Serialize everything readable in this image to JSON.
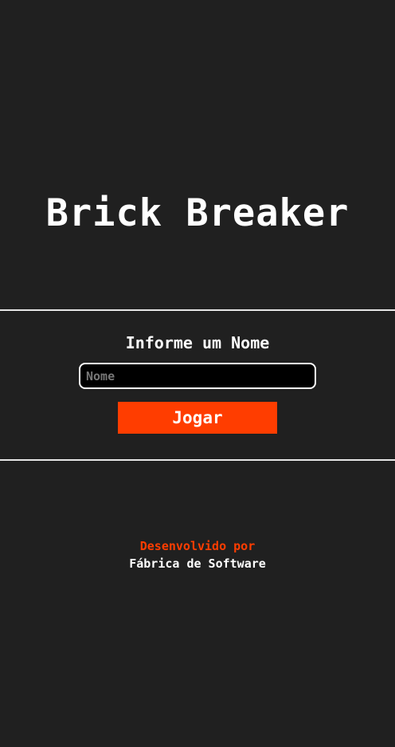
{
  "game": {
    "title": "Brick Breaker"
  },
  "form": {
    "prompt": "Informe um Nome",
    "name_placeholder": "Nome",
    "name_value": "",
    "play_label": "Jogar"
  },
  "footer": {
    "developed_by": "Desenvolvido por",
    "organization": "Fábrica de Software"
  },
  "colors": {
    "background": "#202020",
    "accent": "#ff3d00",
    "text": "#ffffff",
    "input_background": "#000000"
  }
}
